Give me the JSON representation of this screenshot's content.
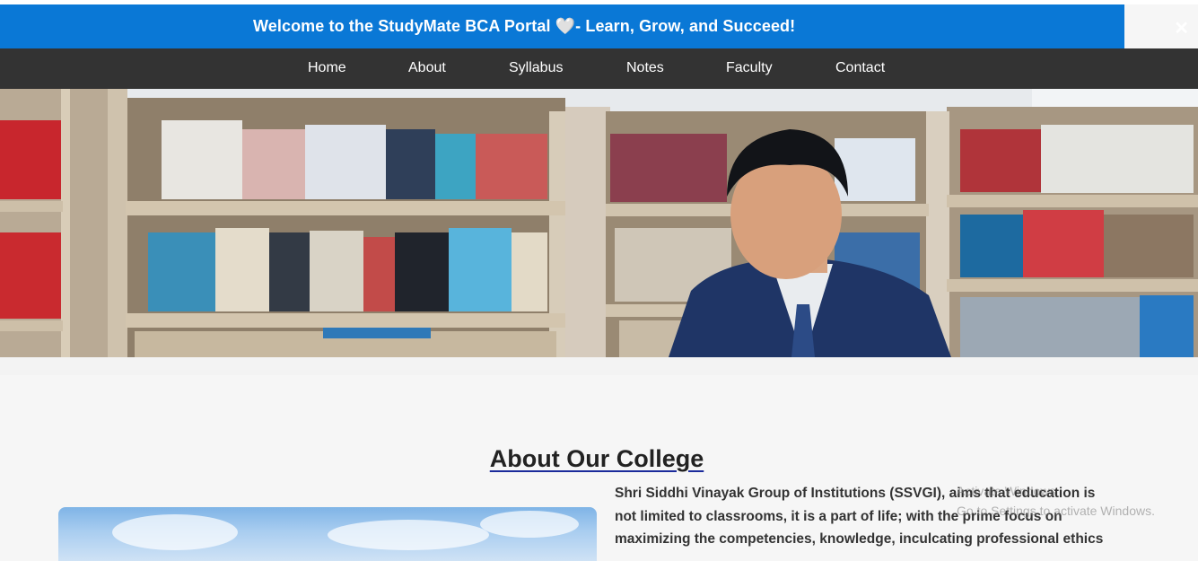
{
  "banner": {
    "text": "Welcome to the StudyMate BCA Portal 🤍- Learn, Grow, and Succeed!",
    "close_icon": "close-icon"
  },
  "nav": {
    "items": [
      "Home",
      "About",
      "Syllabus",
      "Notes",
      "Faculty",
      "Contact"
    ]
  },
  "hero": {
    "image": "library-student-hero"
  },
  "about": {
    "title": "About Our College",
    "lines": [
      "Shri Siddhi Vinayak Group of Institutions (SSVGI), aims that education is",
      "not limited to classrooms, it is a part of life; with the prime focus on",
      "maximizing the competencies, knowledge, inculcating professional ethics"
    ],
    "image": "campus-photo"
  },
  "os_watermark": {
    "line1": "Activate Windows",
    "line2": "Go to Settings to activate Windows."
  },
  "colors": {
    "banner": "#0a78d6",
    "nav": "#333333",
    "background": "#f6f6f6"
  }
}
